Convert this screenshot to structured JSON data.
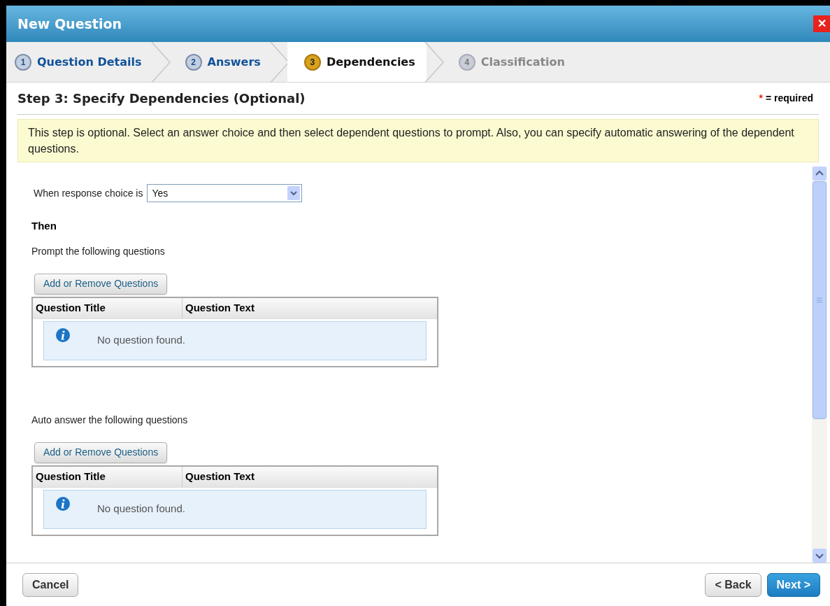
{
  "window": {
    "title": "New Question",
    "close": "✕"
  },
  "steps": [
    {
      "number": "1",
      "label": "Question Details",
      "selected": false,
      "disabled": false
    },
    {
      "number": "2",
      "label": "Answers",
      "selected": false,
      "disabled": false
    },
    {
      "number": "3",
      "label": "Dependencies",
      "selected": true,
      "disabled": false
    },
    {
      "number": "4",
      "label": "Classification",
      "selected": false,
      "disabled": true
    }
  ],
  "heading": "Step 3: Specify Dependencies (Optional)",
  "required_note": {
    "mark": "*",
    "text": "= required"
  },
  "info_banner": "This step is optional. Select an answer choice and then select dependent questions to prompt. Also, you can specify automatic answering of the dependent questions.",
  "response": {
    "label": "When response choice is",
    "value": "Yes"
  },
  "then_label": "Then",
  "sections": [
    {
      "label": "Prompt the following questions",
      "button": "Add or Remove Questions",
      "columns": [
        "Question Title",
        "Question Text"
      ],
      "empty_message": "No question found."
    },
    {
      "label": "Auto answer the following questions",
      "button": "Add or Remove Questions",
      "columns": [
        "Question Title",
        "Question Text"
      ],
      "empty_message": "No question found."
    }
  ],
  "footer": {
    "cancel": "Cancel",
    "back": "< Back",
    "next": "Next >"
  }
}
